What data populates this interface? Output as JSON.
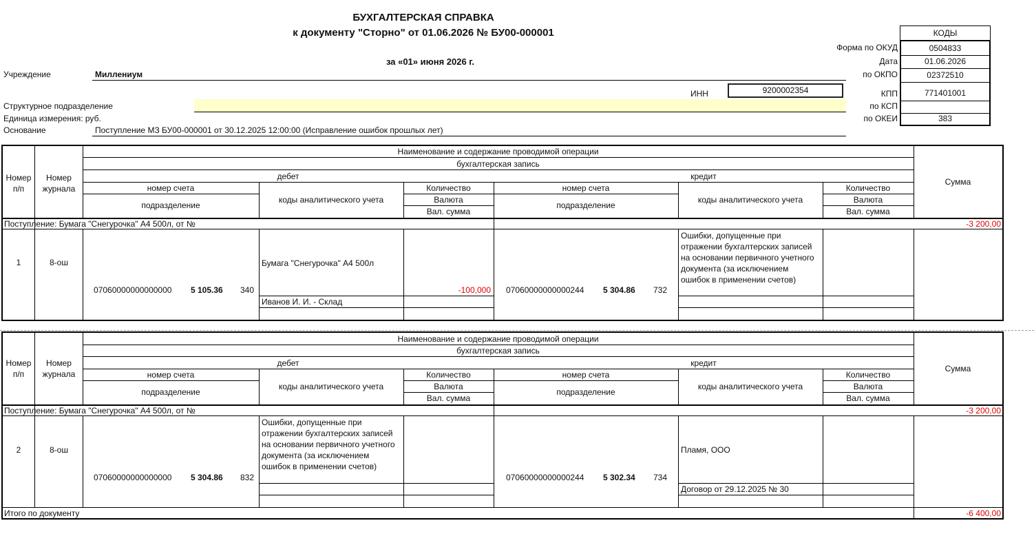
{
  "header": {
    "title": "БУХГАЛТЕРСКАЯ СПРАВКА",
    "subtitle": "к документу \"Сторно\" от 01.06.2026 № БУ00-000001",
    "date_line": "за «01» июня 2026 г."
  },
  "fields": {
    "institution_label": "Учреждение",
    "institution_value": "Миллениум",
    "inn_label": "ИНН",
    "inn_value": "9200002354",
    "struct_label": "Структурное подразделение",
    "unit_label": "Единица измерения: руб.",
    "basis_label": "Основание",
    "basis_value": "Поступление МЗ БУ00-000001 от 30.12.2025 12:00:00 (Исправление ошибок прошлых лет)"
  },
  "codes": {
    "header": "КОДЫ",
    "rows": [
      {
        "label": "Форма  по ОКУД",
        "value": "0504833"
      },
      {
        "label": "Дата",
        "value": "01.06.2026"
      },
      {
        "label": "по ОКПО",
        "value": "02372510"
      },
      {
        "label": "КПП",
        "value": "771401001"
      },
      {
        "label": "по КСП",
        "value": ""
      },
      {
        "label": "по ОКЕИ",
        "value": "383"
      }
    ]
  },
  "table_header": {
    "num": "Номер п/п",
    "journal": "Номер журнала",
    "operation": "Наименование и содержание проводимой операции",
    "entry": "бухгалтерская запись",
    "debit": "дебет",
    "credit": "кредит",
    "account_no": "номер счета",
    "subdivision": "подразделение",
    "analytic": "коды аналитического учета",
    "qty": "Количество",
    "currency": "Валюта",
    "cur_sum": "Вал. сумма",
    "sum": "Сумма"
  },
  "blocks": [
    {
      "caption": "Поступление: Бумага \"Снегурочка\" А4 500л,  от  №",
      "caption_sum": "-3 200,00",
      "num": "1",
      "journal": "8-ош",
      "debit_account": "07060000000000000",
      "debit_code": "5 105.36",
      "debit_kosgu": "340",
      "debit_analytic": "Бумага \"Снегурочка\" А4 500л",
      "debit_analytic2": "Иванов И. И. - Склад",
      "debit_qty": "-100,000",
      "credit_account": "07060000000000244",
      "credit_code": "5 304.86",
      "credit_kosgu": "732",
      "credit_analytic": "Ошибки, допущенные при отражении бухгалтерских записей на основании первичного учетного документа (за исключением ошибок в применении счетов)",
      "credit_analytic2": ""
    },
    {
      "caption": "Поступление: Бумага \"Снегурочка\" А4 500л,  от  №",
      "caption_sum": "-3 200,00",
      "num": "2",
      "journal": "8-ош",
      "debit_account": "07060000000000000",
      "debit_code": "5 304.86",
      "debit_kosgu": "832",
      "debit_analytic": "Ошибки, допущенные при отражении бухгалтерских записей на основании первичного учетного документа (за исключением ошибок в применении счетов)",
      "debit_analytic2": "",
      "debit_qty": "",
      "credit_account": "07060000000000244",
      "credit_code": "5 302.34",
      "credit_kosgu": "734",
      "credit_analytic": "Пламя, ООО",
      "credit_analytic2": "Договор от 29.12.2025 № 30"
    }
  ],
  "total": {
    "label": "Итого по документу",
    "value": "-6 400,00"
  }
}
